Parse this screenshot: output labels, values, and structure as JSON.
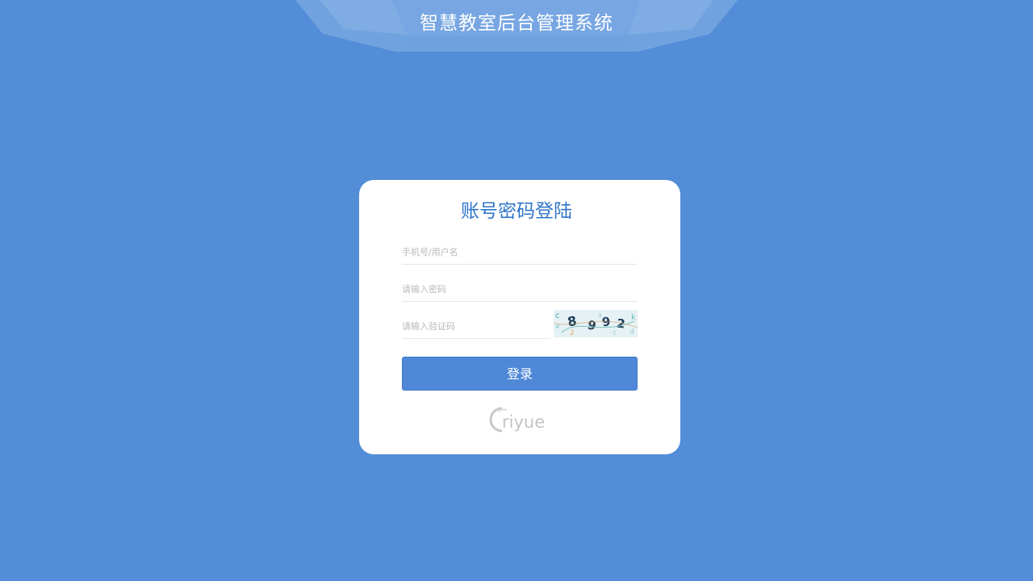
{
  "header": {
    "title": "智慧教室后台管理系统"
  },
  "login_form": {
    "title": "账号密码登陆",
    "account_placeholder": "手机号/用户名",
    "password_placeholder": "请输入密码",
    "captcha_placeholder": "请输入验证码",
    "captcha_code": "8992",
    "submit_label": "登录"
  },
  "brand": {
    "logo_text": "riyue"
  },
  "colors": {
    "background": "#538dd7",
    "accent": "#2f74c9",
    "button": "#4f88d6",
    "card": "#ffffff"
  }
}
